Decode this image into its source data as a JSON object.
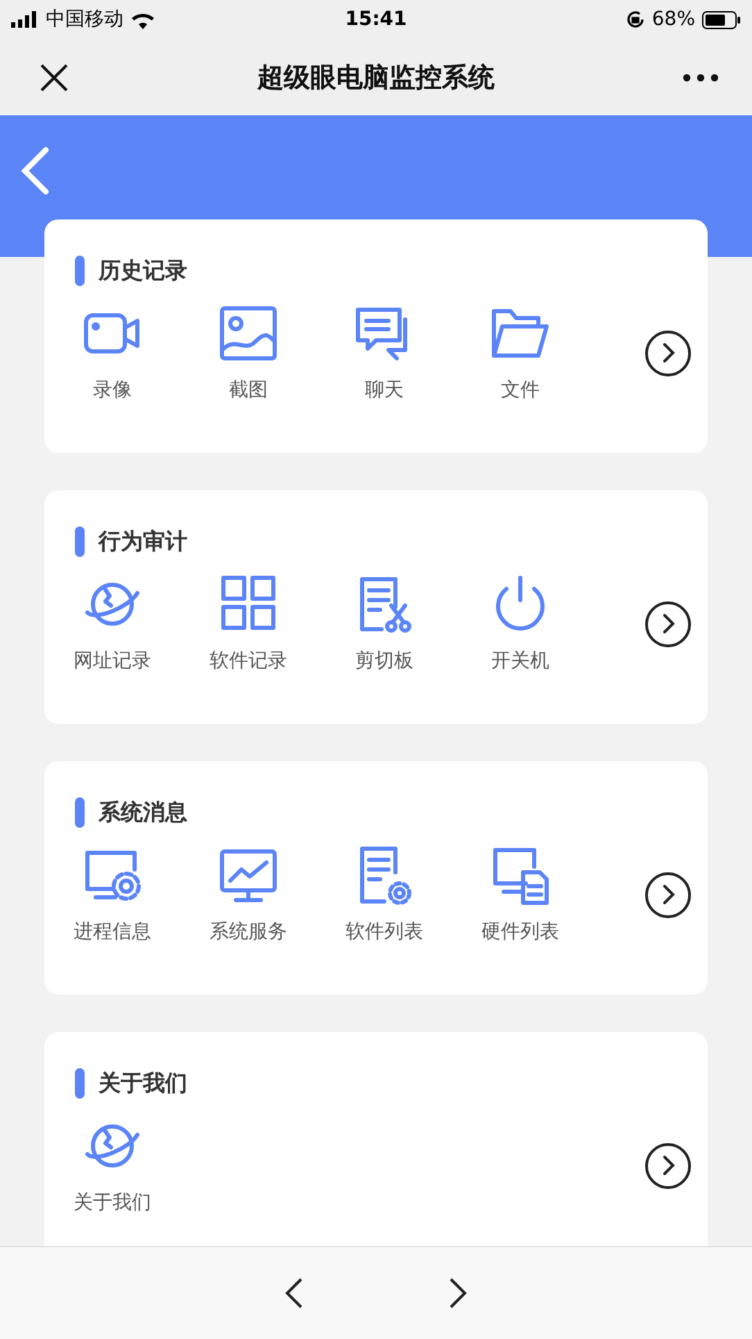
{
  "status_bar": {
    "carrier": "中国移动",
    "time": "15:41",
    "battery": "68%"
  },
  "nav": {
    "title": "超级眼电脑监控系统"
  },
  "sections": [
    {
      "title": "历史记录",
      "items": [
        {
          "label": "录像"
        },
        {
          "label": "截图"
        },
        {
          "label": "聊天"
        },
        {
          "label": "文件"
        }
      ]
    },
    {
      "title": "行为审计",
      "items": [
        {
          "label": "网址记录"
        },
        {
          "label": "软件记录"
        },
        {
          "label": "剪切板"
        },
        {
          "label": "开关机"
        }
      ]
    },
    {
      "title": "系统消息",
      "items": [
        {
          "label": "进程信息"
        },
        {
          "label": "系统服务"
        },
        {
          "label": "软件列表"
        },
        {
          "label": "硬件列表"
        }
      ]
    },
    {
      "title": "关于我们",
      "items": [
        {
          "label": "关于我们"
        }
      ]
    }
  ]
}
